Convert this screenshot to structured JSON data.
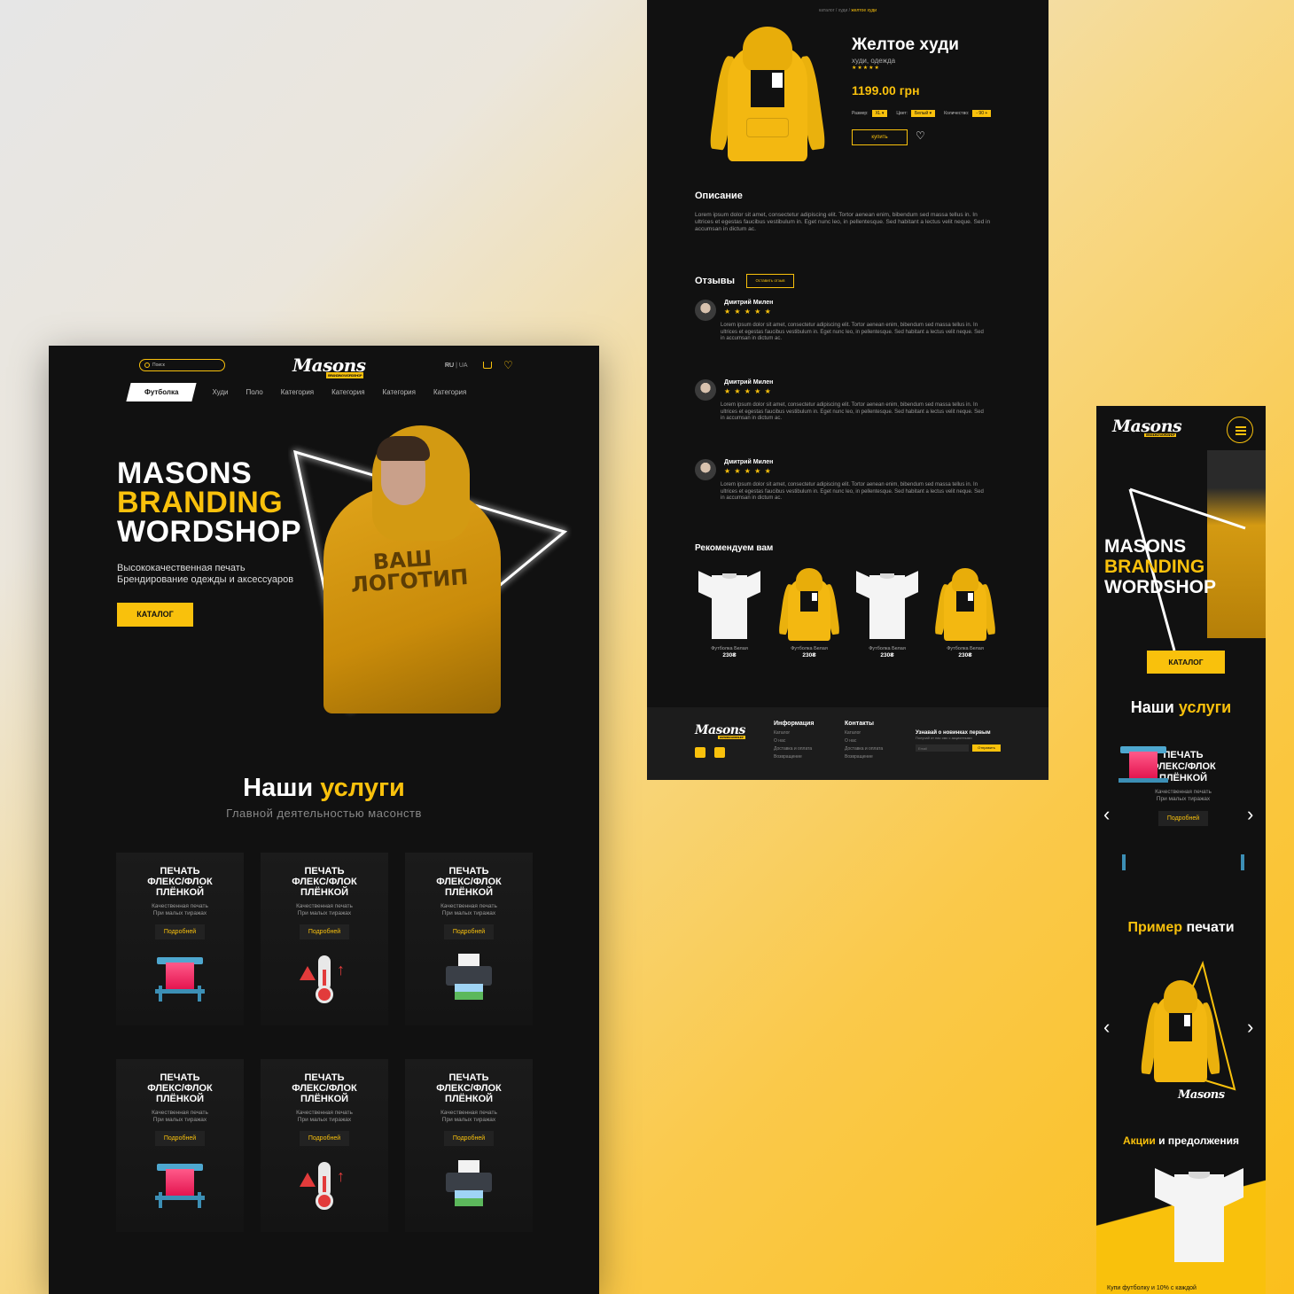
{
  "colors": {
    "accent": "#f9c10c",
    "panel": "#111111",
    "footer": "#1c1c1c"
  },
  "brand": {
    "logo": "Masons",
    "logo_sub": "BRANDING WORDSHOP"
  },
  "desktop": {
    "search_placeholder": "Поиск",
    "lang_ru": "RU",
    "lang_sep": "|",
    "lang_ua": "UA",
    "nav": [
      "Футболка",
      "Худи",
      "Поло",
      "Категория",
      "Категория",
      "Категория",
      "Категория"
    ],
    "hero": {
      "line1": "MASONS",
      "line2": "BRANDING",
      "line3": "WORDSHOP",
      "sub1": "Высококачественная печать",
      "sub2": "Брендирование одежды и аксессуаров",
      "catalog_button": "КАТАЛОГ",
      "print_line1": "ВАШ",
      "print_line2": "ЛОГОТИП"
    },
    "services": {
      "title_white": "Наши",
      "title_yellow": "услуги",
      "subtitle": "Главной деятельностью масонств",
      "cards": [
        {
          "title1": "ПЕЧАТЬ",
          "title2": "ФЛЕКС/ФЛОК",
          "title3": "ПЛЁНКОЙ",
          "desc1": "Качественная печать",
          "desc2": "При малых тиражах",
          "button": "Подробней",
          "icon": "plotter-icon"
        },
        {
          "title1": "ПЕЧАТЬ",
          "title2": "ФЛЕКС/ФЛОК",
          "title3": "ПЛЁНКОЙ",
          "desc1": "Качественная печать",
          "desc2": "При малых тиражах",
          "button": "Подробней",
          "icon": "thermometer-icon"
        },
        {
          "title1": "ПЕЧАТЬ",
          "title2": "ФЛЕКС/ФЛОК",
          "title3": "ПЛЁНКОЙ",
          "desc1": "Качественная печать",
          "desc2": "При малых тиражах",
          "button": "Подробней",
          "icon": "printer-icon"
        },
        {
          "title1": "ПЕЧАТЬ",
          "title2": "ФЛЕКС/ФЛОК",
          "title3": "ПЛЁНКОЙ",
          "desc1": "Качественная печать",
          "desc2": "При малых тиражах",
          "button": "Подробней",
          "icon": "plotter-icon"
        },
        {
          "title1": "ПЕЧАТЬ",
          "title2": "ФЛЕКС/ФЛОК",
          "title3": "ПЛЁНКОЙ",
          "desc1": "Качественная печать",
          "desc2": "При малых тиражах",
          "button": "Подробней",
          "icon": "thermometer-icon"
        },
        {
          "title1": "ПЕЧАТЬ",
          "title2": "ФЛЕКС/ФЛОК",
          "title3": "ПЛЁНКОЙ",
          "desc1": "Качественная печать",
          "desc2": "При малых тиражах",
          "button": "Подробней",
          "icon": "printer-icon"
        }
      ]
    }
  },
  "product": {
    "breadcrumb_1": "каталог",
    "breadcrumb_sep": " / ",
    "breadcrumb_2": "худи",
    "breadcrumb_3": "желтое худи",
    "title": "Желтое худи",
    "category": "худи, одежда",
    "stars": "★★★★★",
    "price": "1199.00 грн",
    "size_label": "Размер:",
    "size_value": "XL ▾",
    "color_label": "Цвет:",
    "color_value": "Белый ▾",
    "qty_label": "Количество:",
    "qty_value": "- 90 +",
    "buy_button": "купить",
    "description_heading": "Описание",
    "description": "Lorem ipsum dolor sit amet, consectetur adipiscing elit. Tortor aenean enim, bibendum sed massa tellus in. In ultrices et egestas faucibus vestibulum in. Eget nunc leo, in pellentesque. Sed habitant a lectus velit neque. Sed in accumsan in dictum ac.",
    "reviews_heading": "Отзывы",
    "leave_review_button": "Оставить отзыв",
    "reviews": [
      {
        "name": "Дмитрий Милен",
        "stars": "★ ★ ★ ★ ★",
        "text": "Lorem ipsum dolor sit amet, consectetur adipiscing elit. Tortor aenean enim, bibendum sed massa tellus in. In ultrices et egestas faucibus vestibulum in. Eget nunc leo, in pellentesque. Sed habitant a lectus velit neque. Sed in accumsan in dictum ac."
      },
      {
        "name": "Дмитрий Милен",
        "stars": "★ ★ ★ ★ ★",
        "text": "Lorem ipsum dolor sit amet, consectetur adipiscing elit. Tortor aenean enim, bibendum sed massa tellus in. In ultrices et egestas faucibus vestibulum in. Eget nunc leo, in pellentesque. Sed habitant a lectus velit neque. Sed in accumsan in dictum ac."
      },
      {
        "name": "Дмитрий Милен",
        "stars": "★ ★ ★ ★ ★",
        "text": "Lorem ipsum dolor sit amet, consectetur adipiscing elit. Tortor aenean enim, bibendum sed massa tellus in. In ultrices et egestas faucibus vestibulum in. Eget nunc leo, in pellentesque. Sed habitant a lectus velit neque. Sed in accumsan in dictum ac."
      }
    ],
    "recommend_heading": "Рекомендуем вам",
    "recommendations": [
      {
        "name": "Футболка Белая",
        "price": "230₴",
        "kind": "white-tshirt"
      },
      {
        "name": "Футболка Белая",
        "price": "230₴",
        "kind": "yellow-hoodie"
      },
      {
        "name": "Футболка Белая",
        "price": "230₴",
        "kind": "white-tshirt"
      },
      {
        "name": "Футболка Белая",
        "price": "230₴",
        "kind": "yellow-hoodie"
      }
    ],
    "footer": {
      "info_heading": "Информация",
      "info_links": [
        "Каталог",
        "О нас",
        "Доставка и оплата",
        "Возвращение"
      ],
      "contacts_heading": "Контакты",
      "contacts_links": [
        "Каталог",
        "О нас",
        "Доставка и оплата",
        "Возвращение"
      ],
      "newsletter_heading": "Узнавай о новинках первым",
      "newsletter_sub": "Получай от нас смс с акционными",
      "email_placeholder": "Email",
      "send_button": "Отправить"
    }
  },
  "mobile": {
    "hero_line1": "MASONS",
    "hero_line2": "BRANDING",
    "hero_line3": "WORDSHOP",
    "catalog_button": "КАТАЛОГ",
    "services_white": "Наши",
    "services_yellow": "услуги",
    "card_title1": "ПЕЧАТЬ",
    "card_title2": "ФЛЕКС/ФЛОК",
    "card_title3": "ПЛЁНКОЙ",
    "card_desc1": "Качественная печать",
    "card_desc2": "При малых тиражах",
    "card_button": "Подробней",
    "example_yellow": "Пример",
    "example_white": "печати",
    "promo_yellow": "Акции",
    "promo_white": "и предолжения",
    "promo_text": "Купи футболку и 10% с каждой",
    "chevron_left": "‹",
    "chevron_right": "›"
  }
}
